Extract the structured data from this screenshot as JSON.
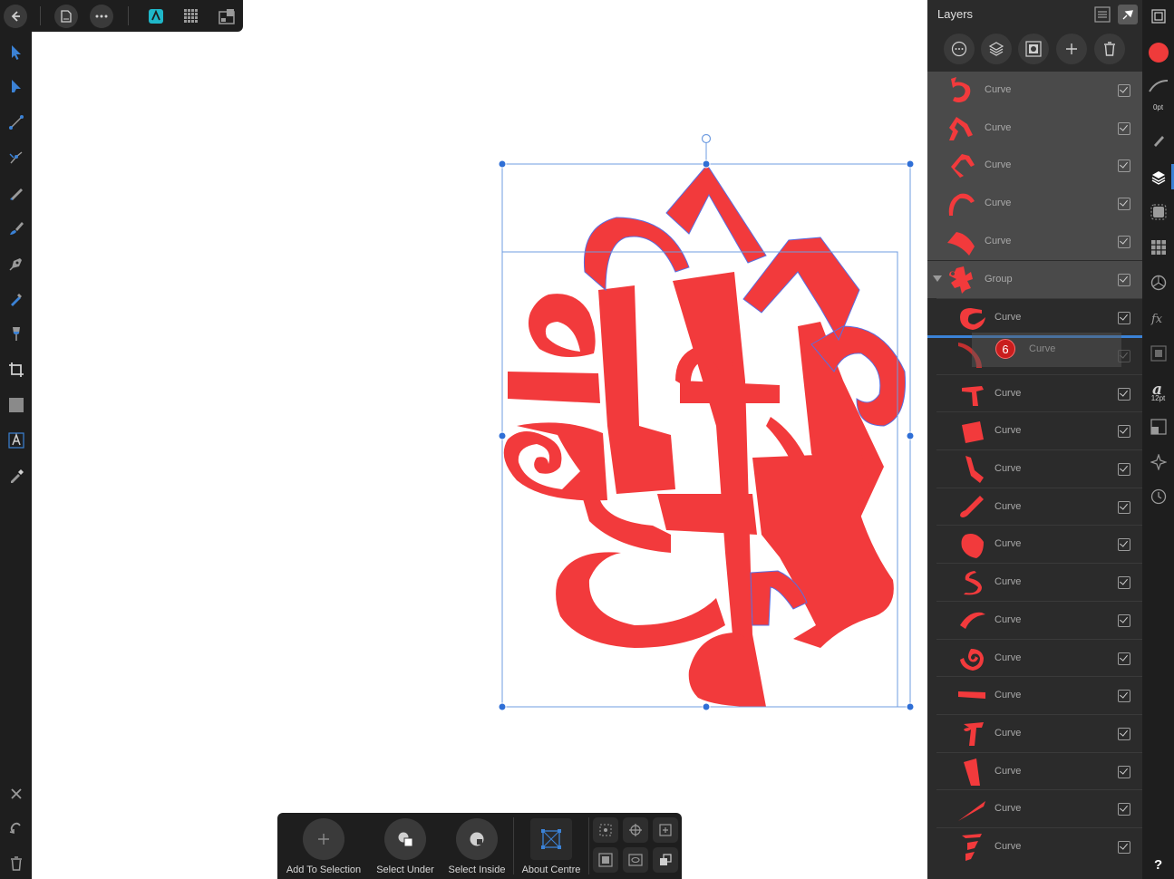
{
  "top_bar": {
    "icons": [
      "back-icon",
      "document-icon",
      "more-icon",
      "designer-persona-icon",
      "pixel-persona-icon",
      "export-persona-icon"
    ]
  },
  "left_tools": {
    "icons": [
      "move-tool-icon",
      "node-tool-icon",
      "corner-tool-icon",
      "point-transform-icon",
      "pencil-tool-icon",
      "vector-brush-icon",
      "pen-tool-icon",
      "fill-tool-icon",
      "transparency-tool-icon",
      "crop-tool-icon",
      "rectangle-tool-icon",
      "artistic-text-icon",
      "color-picker-icon"
    ],
    "bottom_icons": [
      "close-icon",
      "undo-icon",
      "delete-icon"
    ]
  },
  "context_bar": {
    "add_to_selection": "Add To Selection",
    "select_under": "Select Under",
    "select_inside": "Select Inside",
    "about_centre": "About Centre"
  },
  "layers_panel": {
    "title": "Layers",
    "drag_badge": "6",
    "drag_label": "Curve",
    "layers": [
      {
        "name": "Curve",
        "indent": false,
        "selected": true
      },
      {
        "name": "Curve",
        "indent": false,
        "selected": true
      },
      {
        "name": "Curve",
        "indent": false,
        "selected": true
      },
      {
        "name": "Curve",
        "indent": false,
        "selected": true
      },
      {
        "name": "Curve",
        "indent": false,
        "selected": true
      },
      {
        "name": "Group",
        "indent": false,
        "selected": true,
        "group": true
      },
      {
        "name": "Curve",
        "indent": true
      },
      {
        "name": "",
        "indent": true,
        "dragging": true
      },
      {
        "name": "Curve",
        "indent": true
      },
      {
        "name": "Curve",
        "indent": true
      },
      {
        "name": "Curve",
        "indent": true
      },
      {
        "name": "Curve",
        "indent": true
      },
      {
        "name": "Curve",
        "indent": true
      },
      {
        "name": "Curve",
        "indent": true
      },
      {
        "name": "Curve",
        "indent": true
      },
      {
        "name": "Curve",
        "indent": true
      },
      {
        "name": "Curve",
        "indent": true
      },
      {
        "name": "Curve",
        "indent": true
      },
      {
        "name": "Curve",
        "indent": true
      },
      {
        "name": "Curve",
        "indent": true
      },
      {
        "name": "Curve",
        "indent": true
      }
    ]
  },
  "studio_bar": {
    "stroke_width": "0pt",
    "font_size": "12pt",
    "fill_color": "#ef3b3b"
  },
  "colors": {
    "accent": "#3b82d6",
    "shape_red": "#f23a3c"
  }
}
